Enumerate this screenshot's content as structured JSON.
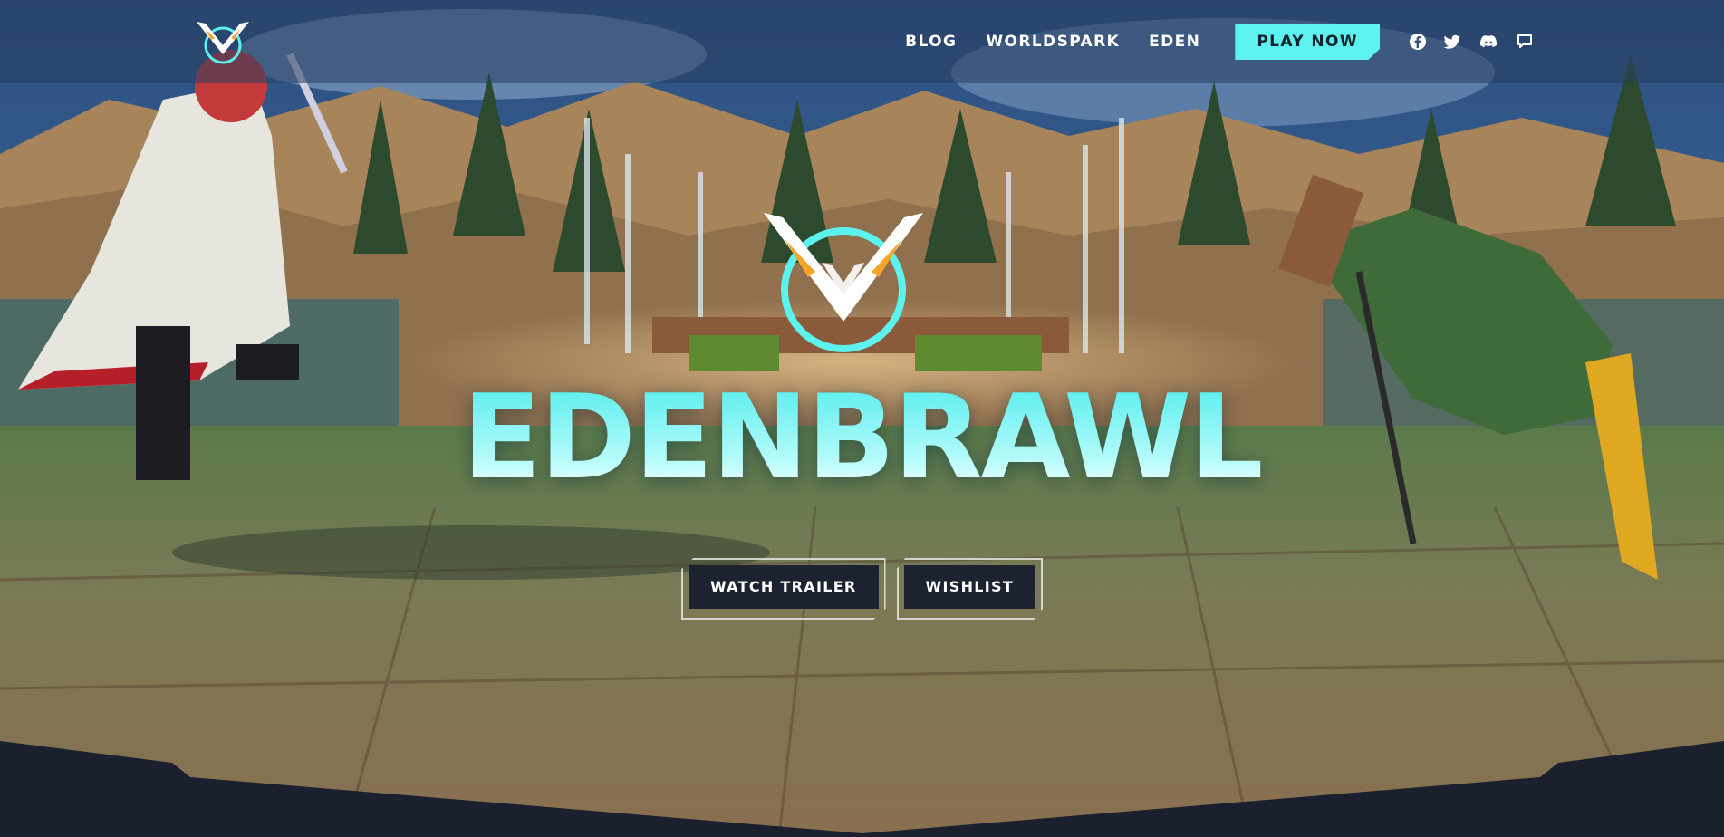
{
  "header": {
    "logo_name": "edenbrawl-logo",
    "nav": [
      {
        "label": "BLOG"
      },
      {
        "label": "WORLDSPARK"
      },
      {
        "label": "EDEN"
      }
    ],
    "cta_label": "PLAY NOW",
    "social_icons": [
      "facebook-icon",
      "twitter-icon",
      "discord-icon",
      "chat-icon"
    ]
  },
  "hero": {
    "title": "EDENBRAWL",
    "buttons": [
      {
        "label": "WATCH TRAILER"
      },
      {
        "label": "WISHLIST"
      }
    ]
  },
  "colors": {
    "accent": "#5ef2ef",
    "button_dark": "#1c2230",
    "footer_bg": "#1a202d",
    "logo_orange": "#f4a52a"
  }
}
